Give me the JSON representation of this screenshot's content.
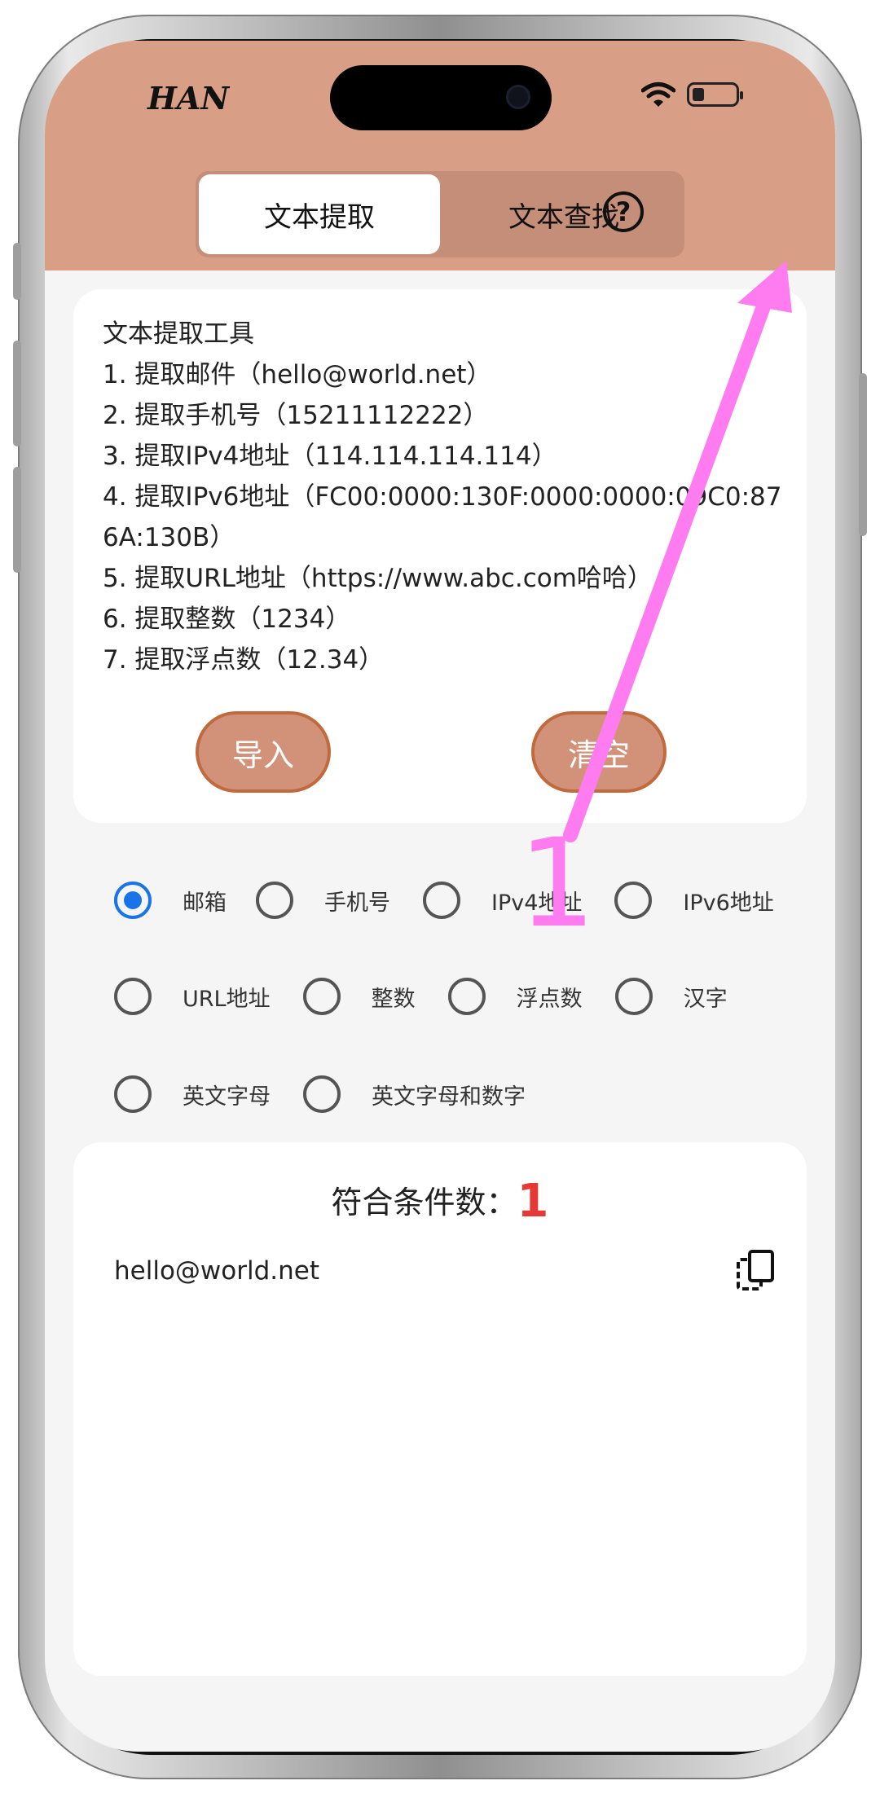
{
  "brand": "HAN",
  "tabs": [
    {
      "label": "文本提取",
      "active": true
    },
    {
      "label": "文本查找",
      "active": false
    }
  ],
  "help_icon": "question-circle-icon",
  "info_lines": [
    "文本提取工具",
    "1. 提取邮件（hello@world.net）",
    "2. 提取手机号（15211112222）",
    "3. 提取IPv4地址（114.114.114.114）",
    "4. 提取IPv6地址（FC00:0000:130F:0000:0000:09C0:876A:130B）",
    "5. 提取URL地址（https://www.abc.com哈哈）",
    "6. 提取整数（1234）",
    "7. 提取浮点数（12.34）"
  ],
  "buttons": {
    "import": "导入",
    "clear": "清空"
  },
  "options": [
    {
      "label": "邮箱",
      "checked": true
    },
    {
      "label": "手机号",
      "checked": false
    },
    {
      "label": "IPv4地址",
      "checked": false
    },
    {
      "label": "IPv6地址",
      "checked": false
    },
    {
      "label": "URL地址",
      "checked": false
    },
    {
      "label": "整数",
      "checked": false
    },
    {
      "label": "浮点数",
      "checked": false
    },
    {
      "label": "汉字",
      "checked": false
    },
    {
      "label": "英文字母",
      "checked": false
    },
    {
      "label": "英文字母和数字",
      "checked": false
    }
  ],
  "result": {
    "count_label": "符合条件数：",
    "count": "1",
    "items": [
      "hello@world.net"
    ]
  },
  "annotation": {
    "number": "1",
    "color": "#ff7cf0"
  },
  "colors": {
    "header": "#d89e86",
    "button": "#d2927a",
    "radio_checked": "#1a73e8",
    "count": "#e53935"
  }
}
